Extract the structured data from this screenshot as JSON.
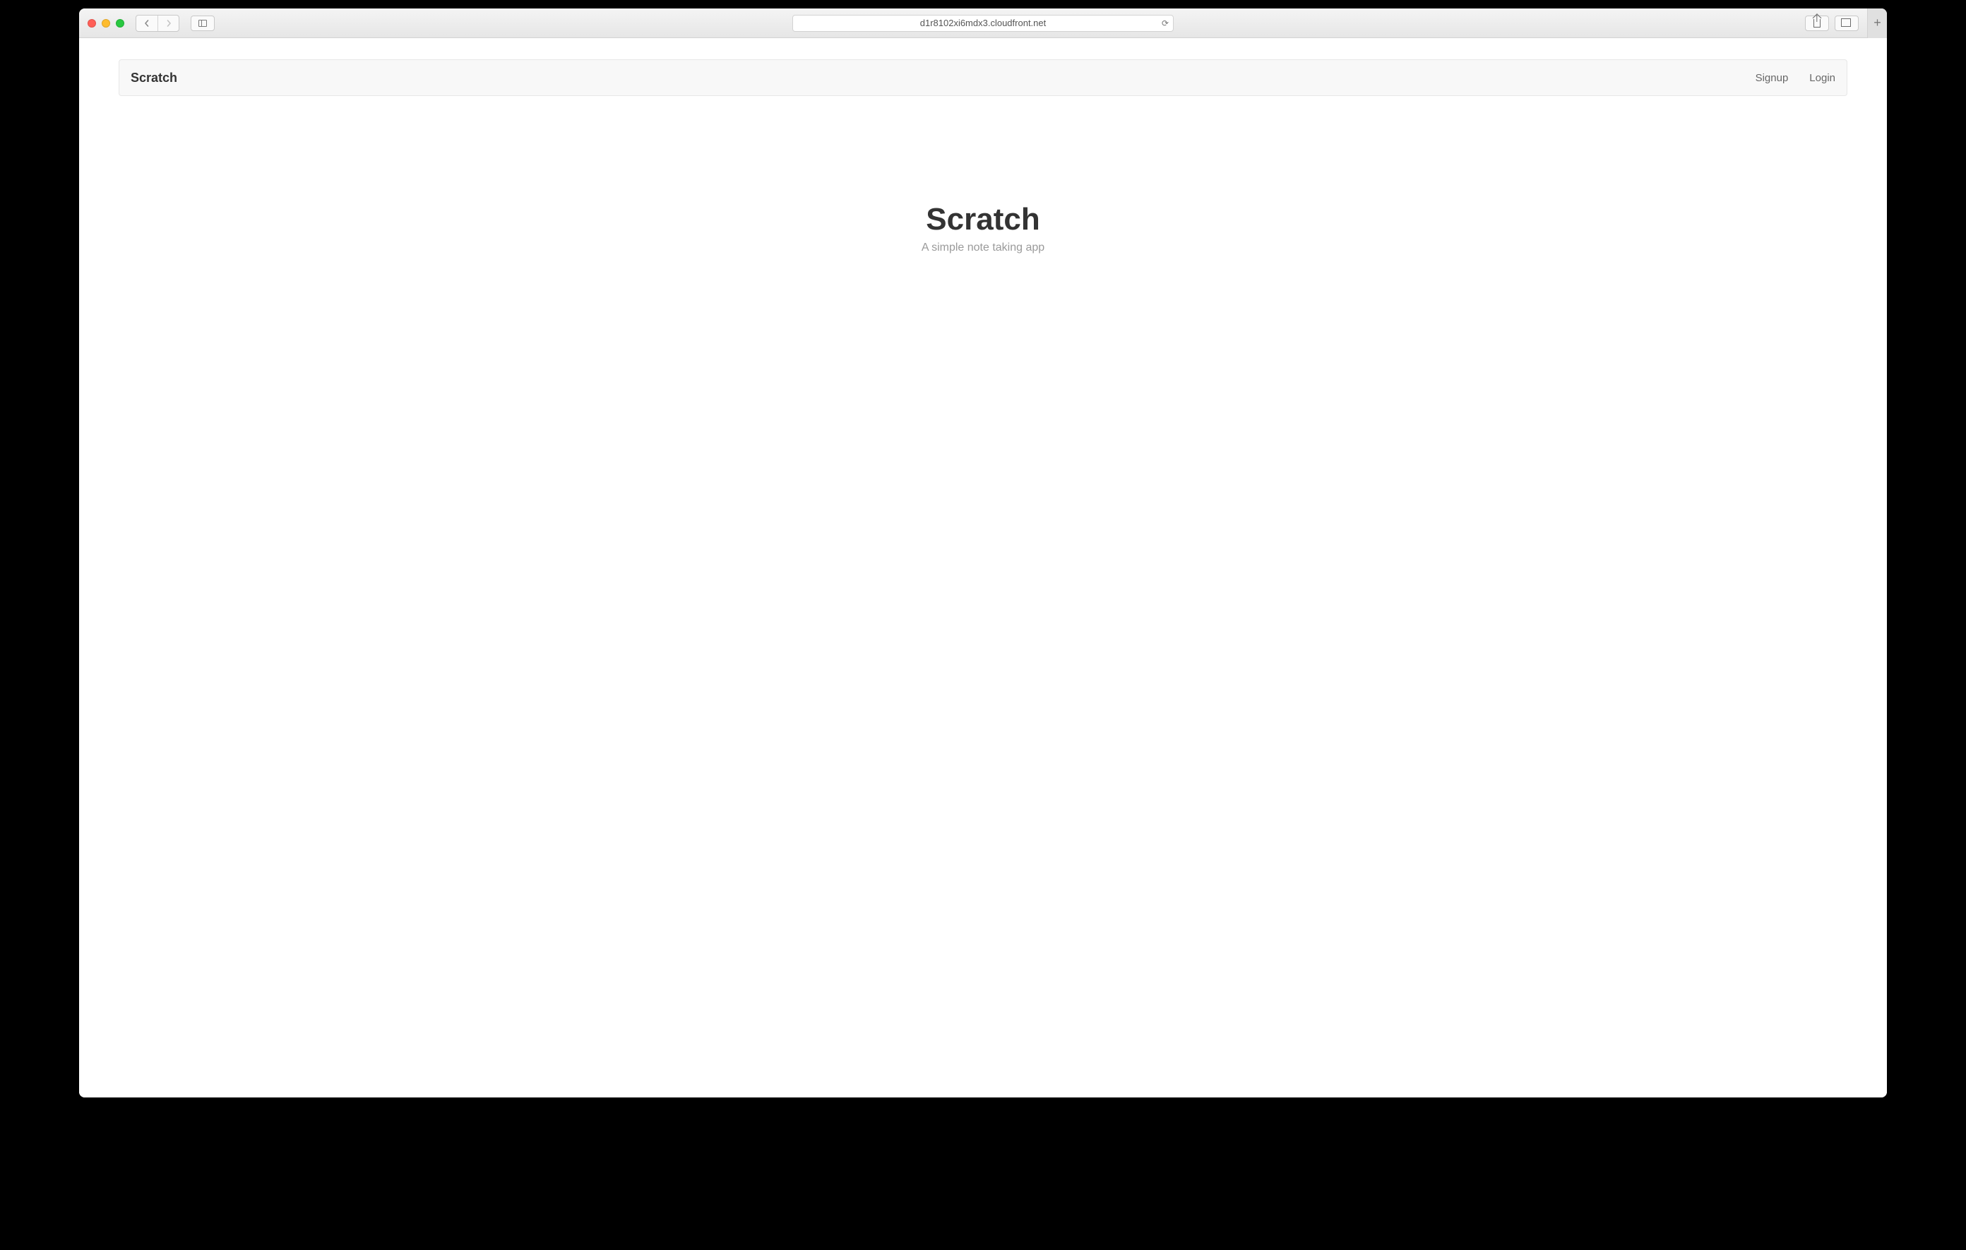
{
  "browser": {
    "url": "d1r8102xi6mdx3.cloudfront.net"
  },
  "navbar": {
    "brand": "Scratch",
    "links": {
      "signup": "Signup",
      "login": "Login"
    }
  },
  "hero": {
    "title": "Scratch",
    "subtitle": "A simple note taking app"
  }
}
